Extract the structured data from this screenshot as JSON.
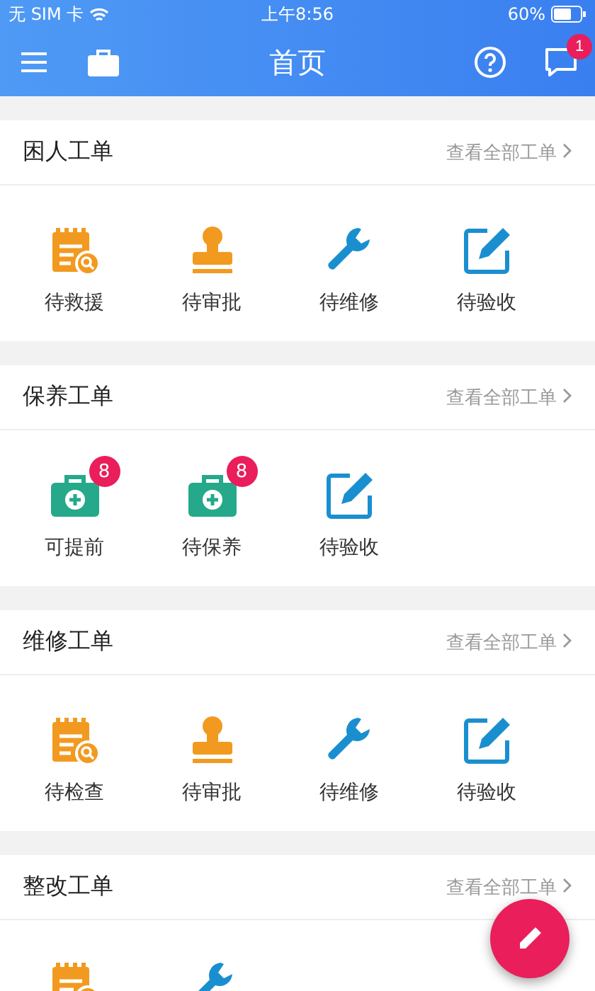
{
  "status_bar": {
    "carrier": "无 SIM 卡",
    "time": "上午8:56",
    "battery": "60%"
  },
  "header": {
    "title": "首页",
    "message_badge": "1"
  },
  "sections": [
    {
      "title": "困人工单",
      "link": "查看全部工单",
      "items": [
        {
          "kind": "notepad",
          "label": "待救援"
        },
        {
          "kind": "stamp",
          "label": "待审批"
        },
        {
          "kind": "wrench",
          "label": "待维修"
        },
        {
          "kind": "edit",
          "label": "待验收"
        }
      ]
    },
    {
      "title": "保养工单",
      "link": "查看全部工单",
      "items": [
        {
          "kind": "medkit",
          "label": "可提前",
          "badge": "8"
        },
        {
          "kind": "medkit",
          "label": "待保养",
          "badge": "8"
        },
        {
          "kind": "edit",
          "label": "待验收"
        }
      ]
    },
    {
      "title": "维修工单",
      "link": "查看全部工单",
      "items": [
        {
          "kind": "notepad",
          "label": "待检查"
        },
        {
          "kind": "stamp",
          "label": "待审批"
        },
        {
          "kind": "wrench",
          "label": "待维修"
        },
        {
          "kind": "edit",
          "label": "待验收"
        }
      ]
    },
    {
      "title": "整改工单",
      "link": "查看全部工单",
      "items": [
        {
          "kind": "notepad"
        },
        {
          "kind": "wrench"
        }
      ]
    }
  ]
}
